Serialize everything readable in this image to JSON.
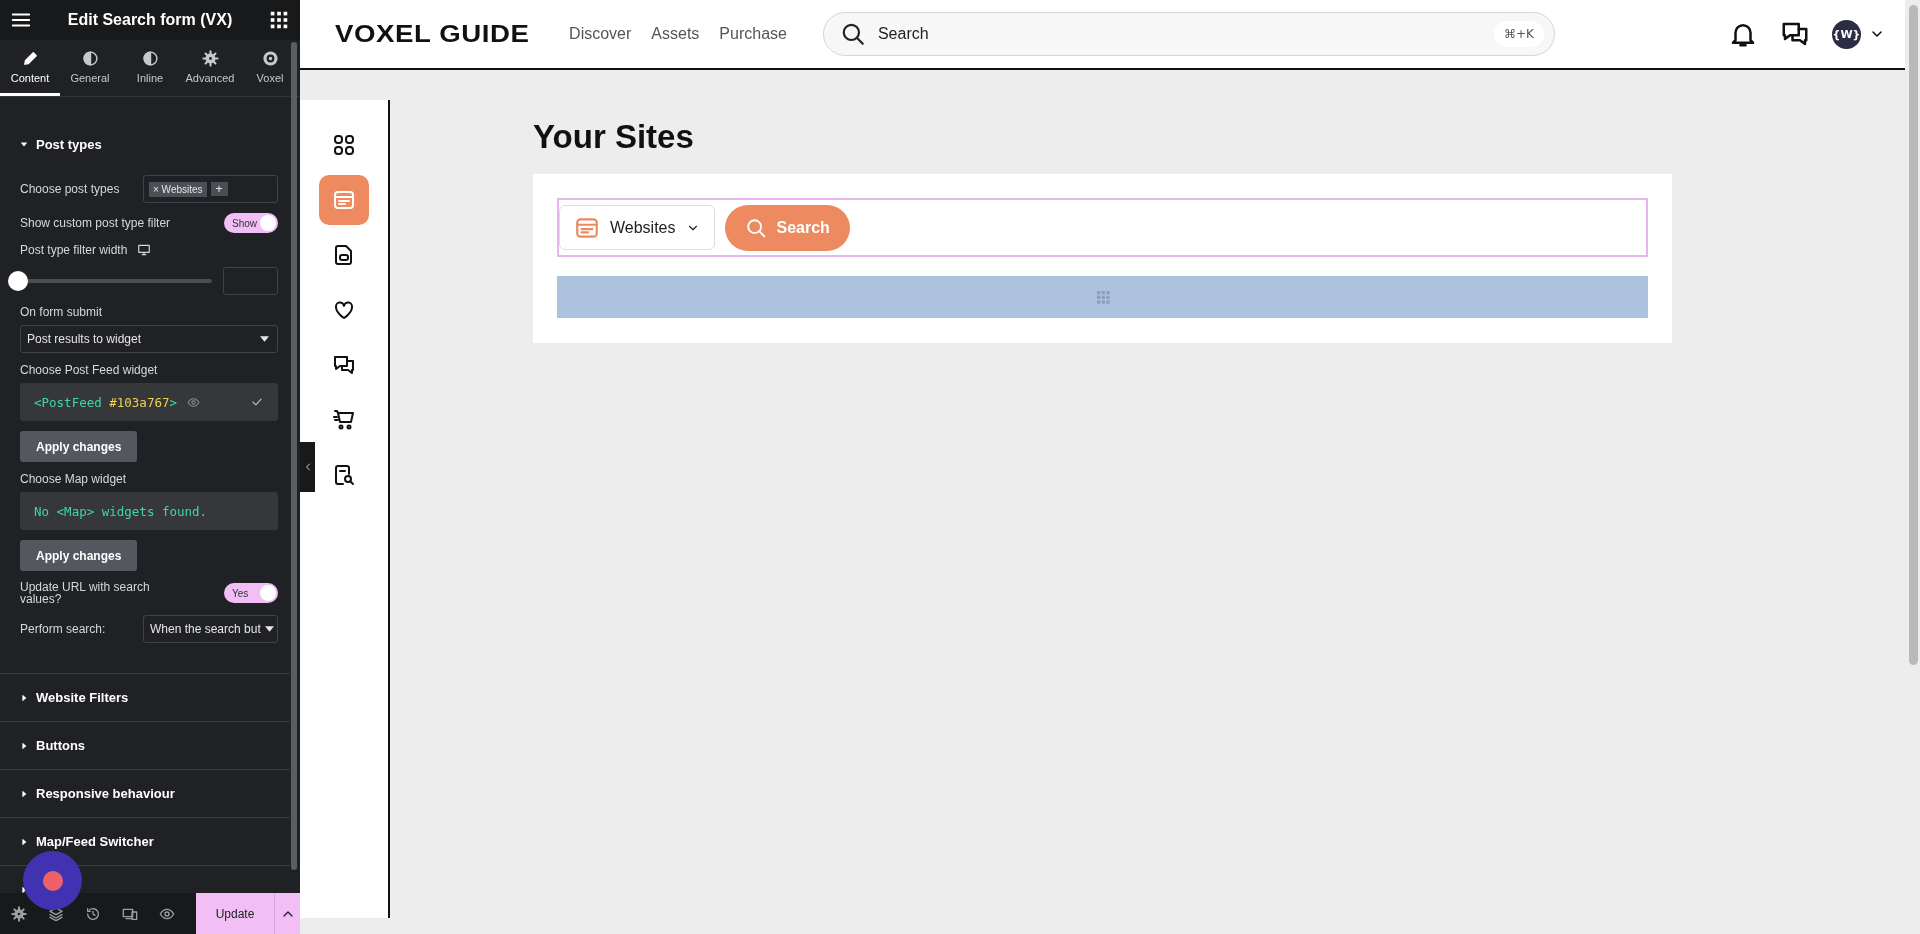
{
  "editor": {
    "title": "Edit Search form (VX)",
    "tabs": [
      {
        "label": "Content",
        "selected": true
      },
      {
        "label": "General",
        "selected": false
      },
      {
        "label": "Inline",
        "selected": false
      },
      {
        "label": "Advanced",
        "selected": false
      },
      {
        "label": "Voxel",
        "selected": false
      }
    ],
    "sections": [
      {
        "title": "Post types",
        "expanded": true,
        "controls": [
          {
            "kind": "chips",
            "label": "Choose post types",
            "chips": [
              {
                "remove": "×",
                "label": "Websites"
              }
            ],
            "add": "+"
          },
          {
            "kind": "switch",
            "label": "Show custom post type filter",
            "text": "Show",
            "on": true
          },
          {
            "kind": "heading",
            "label": "Post type filter width"
          },
          {
            "kind": "slider",
            "level": 0
          },
          {
            "kind": "label",
            "label": "On form submit"
          },
          {
            "kind": "select",
            "value": "Post results to widget"
          },
          {
            "kind": "label",
            "label": "Choose Post Feed widget"
          },
          {
            "kind": "picker",
            "parts": [
              {
                "text": "<PostFeed ",
                "kind": "tag"
              },
              {
                "text": "#103a767",
                "kind": "id"
              },
              {
                "text": ">",
                "kind": "tag"
              }
            ]
          },
          {
            "kind": "button",
            "text": "Apply changes"
          },
          {
            "kind": "label",
            "label": "Choose Map widget"
          },
          {
            "kind": "message",
            "parts": [
              {
                "text": "No <Map> widgets found.",
                "kind": "tag"
              }
            ]
          },
          {
            "kind": "button",
            "text": "Apply changes"
          },
          {
            "kind": "switch",
            "label": "Update URL with search values?",
            "text": "Yes",
            "on": true
          },
          {
            "kind": "select",
            "label": "Perform search:",
            "value": "When the search but"
          }
        ]
      },
      {
        "title": "Website Filters",
        "expanded": false
      },
      {
        "title": "Buttons",
        "expanded": false
      },
      {
        "title": "Responsive behaviour",
        "expanded": false
      },
      {
        "title": "Map/Feed Switcher",
        "expanded": false
      }
    ],
    "footer": {
      "update": "Update"
    }
  },
  "site": {
    "logo": "VOXEL GUIDE",
    "nav": [
      "Discover",
      "Assets",
      "Purchase"
    ],
    "search": {
      "placeholder": "Search",
      "shortcut": "⌘+K"
    },
    "avatar": "{W}",
    "sidebar": [
      {
        "selected": false
      },
      {
        "selected": true
      },
      {
        "selected": false
      },
      {
        "selected": false
      },
      {
        "selected": false
      },
      {
        "selected": false
      },
      {
        "selected": false
      }
    ],
    "heading": "Your Sites",
    "form": {
      "filter": "Websites",
      "button": "Search"
    }
  }
}
